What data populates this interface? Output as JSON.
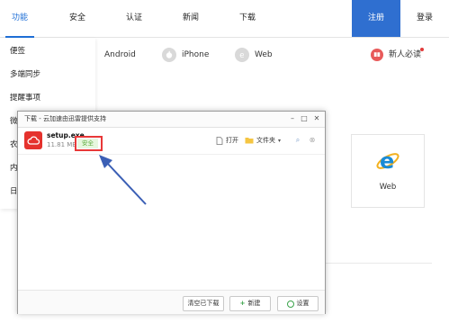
{
  "topnav": {
    "tabs": [
      {
        "label": "功能"
      },
      {
        "label": "安全"
      },
      {
        "label": "认证"
      },
      {
        "label": "新闻"
      },
      {
        "label": "下载"
      }
    ],
    "register_label": "注册",
    "login_label": "登录"
  },
  "platforms": {
    "android": "Android",
    "iphone": "iPhone",
    "web": "Web",
    "newbie": "新人必读"
  },
  "dropdown": {
    "items": [
      "便签",
      "多端同步",
      "提醒事项",
      "微",
      "农",
      "内",
      "日"
    ]
  },
  "webcard": {
    "label": "Web"
  },
  "dialog": {
    "title": "下载 - 云加速由迅雷提供支持",
    "file_name": "setup.exe",
    "file_size": "11.81 MB",
    "safe_badge": "安全",
    "open_label": "打开",
    "folder_label": "文件夹",
    "clear_label": "清空已下载",
    "new_label": "新建",
    "settings_label": "设置"
  },
  "colors": {
    "accent_blue": "#2f6fd0",
    "highlight_red": "#e83838",
    "file_icon_red": "#e5322d",
    "safe_green": "#5aa83a"
  }
}
